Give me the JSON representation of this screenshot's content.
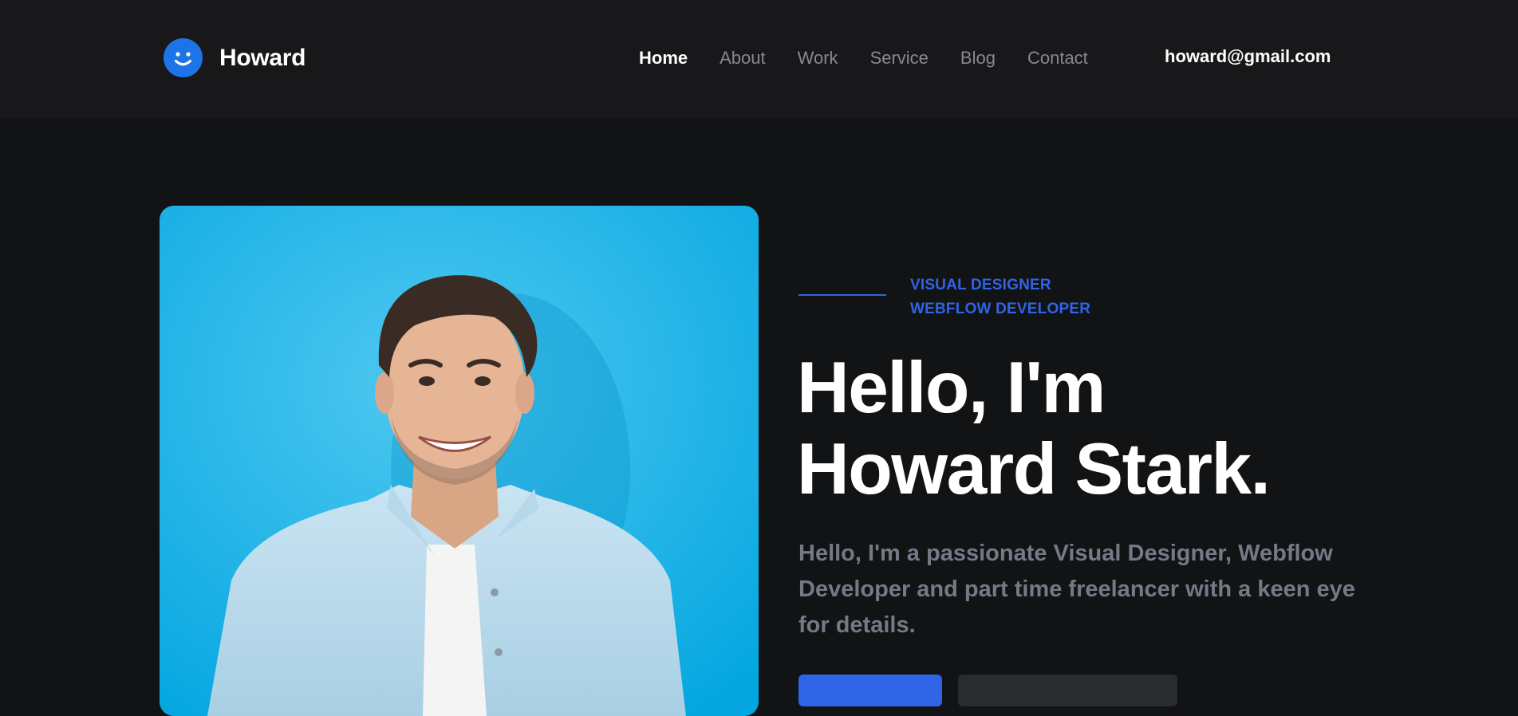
{
  "header": {
    "brand": "Howard",
    "nav": [
      {
        "label": "Home",
        "active": true
      },
      {
        "label": "About",
        "active": false
      },
      {
        "label": "Work",
        "active": false
      },
      {
        "label": "Service",
        "active": false
      },
      {
        "label": "Blog",
        "active": false
      },
      {
        "label": "Contact",
        "active": false
      }
    ],
    "email": "howard@gmail.com"
  },
  "hero": {
    "eyebrow_lines": [
      "VISUAL DESIGNER",
      "WEBFLOW DEVELOPER"
    ],
    "headline_lines": [
      "Hello, I'm",
      "Howard Stark."
    ],
    "intro": "Hello, I'm a passionate Visual Designer, Webflow Developer and part time freelancer with a keen eye for details."
  },
  "colors": {
    "accent": "#2f64e6",
    "header_bg": "#18181a",
    "page_bg": "#121315",
    "photo_bg": "#10b0e6"
  },
  "icons": {
    "logo": "smiley-face-icon"
  }
}
